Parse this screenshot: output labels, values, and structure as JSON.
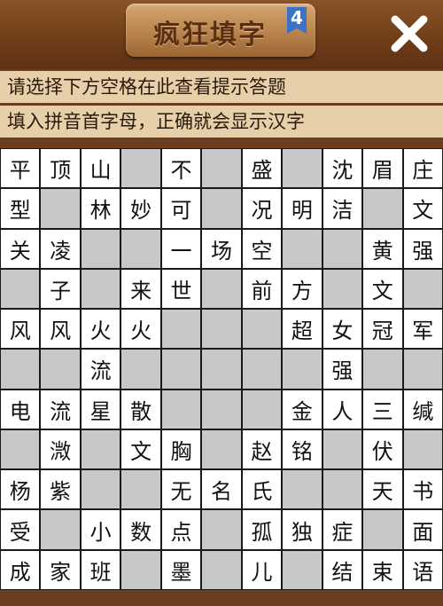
{
  "header": {
    "title": "疯狂填字",
    "version": "4"
  },
  "hints": {
    "line1": "请选择下方空格在此查看提示答题",
    "line2": "填入拼音首字母，正确就会显示汉字"
  },
  "colors": {
    "wood": "#6b3e1f",
    "hint_background": "#e6cfa9",
    "blocked_cell": "#c8c8c8",
    "open_cell": "#ffffff",
    "badge": "#3b73c9"
  },
  "board": {
    "columns": 11,
    "rows": [
      [
        "平",
        "顶",
        "山",
        "#",
        "不",
        "",
        "盛",
        "",
        "沈",
        "眉",
        "庄"
      ],
      [
        "型",
        "",
        "林",
        "妙",
        "可",
        "",
        "况",
        "明",
        "洁",
        "",
        "文"
      ],
      [
        "关",
        "凌",
        "",
        "",
        "一",
        "场",
        "空",
        "",
        "",
        "黄",
        "强"
      ],
      [
        "",
        "子",
        "",
        "来",
        "世",
        "",
        "前",
        "方",
        "",
        "文",
        ""
      ],
      [
        "风",
        "风",
        "火",
        "火",
        "",
        "",
        "",
        "超",
        "女",
        "冠",
        "军"
      ],
      [
        "",
        "",
        "流",
        "",
        "",
        "",
        "",
        "",
        "强",
        "",
        ""
      ],
      [
        "电",
        "流",
        "星",
        "散",
        "",
        "",
        "",
        "金",
        "人",
        "三",
        "缄"
      ],
      [
        "",
        "溦",
        "",
        "文",
        "胸",
        "",
        "赵",
        "铭",
        "",
        "伏",
        ""
      ],
      [
        "杨",
        "紫",
        "",
        "",
        "无",
        "名",
        "氏",
        "",
        "",
        "天",
        "书"
      ],
      [
        "受",
        "",
        "小",
        "数",
        "点",
        "",
        "孤",
        "独",
        "症",
        "",
        "面"
      ],
      [
        "成",
        "家",
        "班",
        "",
        "墨",
        "",
        "儿",
        "",
        "结",
        "束",
        "语"
      ]
    ],
    "open_mask": [
      [
        1,
        1,
        1,
        0,
        1,
        0,
        1,
        0,
        1,
        1,
        1
      ],
      [
        1,
        0,
        1,
        1,
        1,
        0,
        1,
        1,
        1,
        0,
        1
      ],
      [
        1,
        1,
        0,
        0,
        1,
        1,
        1,
        0,
        0,
        1,
        1
      ],
      [
        0,
        1,
        0,
        1,
        1,
        0,
        1,
        1,
        0,
        1,
        0
      ],
      [
        1,
        1,
        1,
        1,
        0,
        0,
        0,
        1,
        1,
        1,
        1
      ],
      [
        0,
        0,
        1,
        0,
        0,
        0,
        0,
        0,
        1,
        0,
        0
      ],
      [
        1,
        1,
        1,
        1,
        0,
        0,
        0,
        1,
        1,
        1,
        1
      ],
      [
        0,
        1,
        0,
        1,
        1,
        0,
        1,
        1,
        0,
        1,
        0
      ],
      [
        1,
        1,
        0,
        0,
        1,
        1,
        1,
        0,
        0,
        1,
        1
      ],
      [
        1,
        0,
        1,
        1,
        1,
        0,
        1,
        1,
        1,
        0,
        1
      ],
      [
        1,
        1,
        1,
        0,
        1,
        0,
        1,
        0,
        1,
        1,
        1
      ]
    ]
  }
}
